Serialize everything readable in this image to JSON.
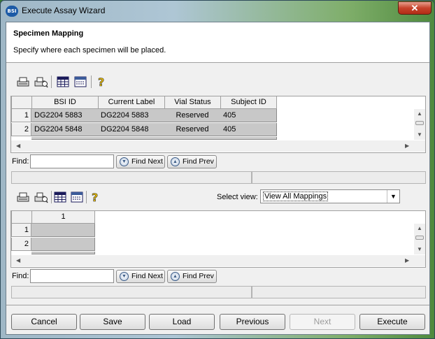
{
  "window": {
    "title": "Execute Assay Wizard",
    "icon_text": "BSI",
    "close_symbol": "✕"
  },
  "header": {
    "title": "Specimen Mapping",
    "description": "Specify where each specimen will be placed."
  },
  "top_grid": {
    "columns": [
      "BSI ID",
      "Current Label",
      "Vial Status",
      "Subject ID"
    ],
    "rows": [
      {
        "num": "1",
        "cells": [
          "DG2204 5883",
          "DG2204 5883",
          "Reserved",
          "405"
        ]
      },
      {
        "num": "2",
        "cells": [
          "DG2204 5848",
          "DG2204 5848",
          "Reserved",
          "405"
        ]
      }
    ]
  },
  "find_top": {
    "label": "Find:",
    "value": "",
    "next": "Find Next",
    "prev": "Find Prev"
  },
  "view_select": {
    "label": "Select view:",
    "value": "View All Mappings"
  },
  "bottom_grid": {
    "columns": [
      "1"
    ],
    "rows": [
      {
        "num": "1"
      },
      {
        "num": "2"
      }
    ]
  },
  "find_bottom": {
    "label": "Find:",
    "value": "",
    "next": "Find Next",
    "prev": "Find Prev"
  },
  "buttons": {
    "cancel": "Cancel",
    "save": "Save",
    "load": "Load",
    "previous": "Previous",
    "next": "Next",
    "execute": "Execute"
  },
  "icons": {
    "toolbar": [
      "print-icon",
      "print-preview-icon",
      "table-view-icon",
      "column-chooser-icon",
      "help-icon"
    ]
  }
}
